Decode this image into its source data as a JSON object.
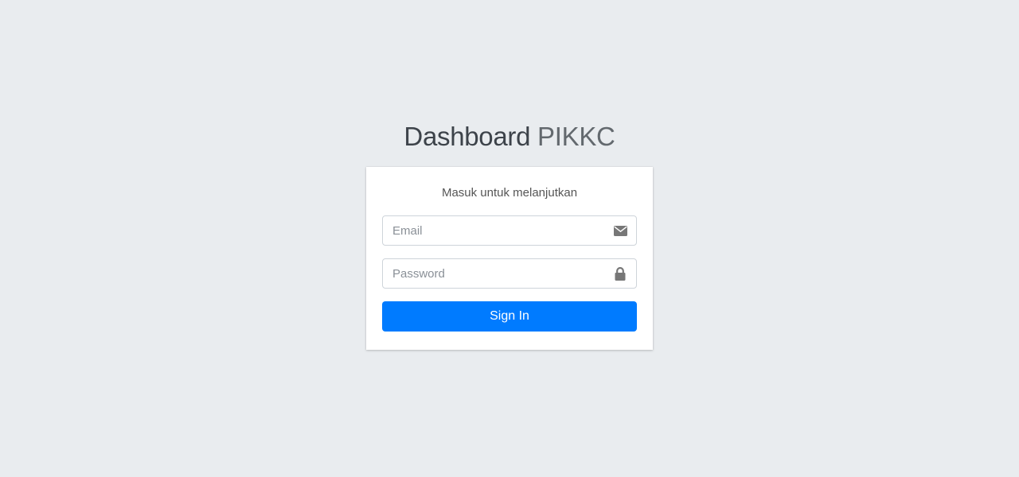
{
  "brand": {
    "title_bold": "Dashboard",
    "title_light": "PIKKC"
  },
  "login": {
    "message": "Masuk untuk melanjutkan",
    "email": {
      "placeholder": "Email",
      "value": "",
      "icon": "envelope-icon"
    },
    "password": {
      "placeholder": "Password",
      "value": "",
      "icon": "lock-icon"
    },
    "submit_label": "Sign In"
  },
  "colors": {
    "background": "#e9ecef",
    "primary": "#007bff",
    "icon": "#777777"
  }
}
